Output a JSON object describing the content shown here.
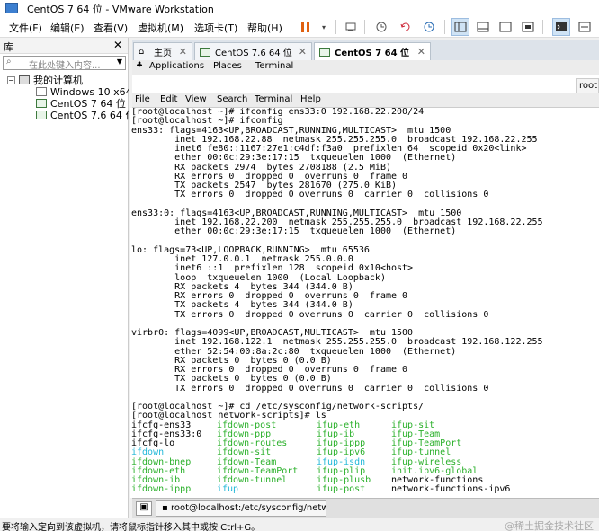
{
  "window": {
    "title": "CentOS 7 64 位 - VMware Workstation"
  },
  "menubar": {
    "items": [
      "文件(F)",
      "编辑(E)",
      "查看(V)",
      "虚拟机(M)",
      "选项卡(T)",
      "帮助(H)"
    ]
  },
  "library": {
    "title": "库",
    "search_placeholder": "在此处键入内容...",
    "tree": [
      {
        "label": "我的计算机",
        "icon": "computer-icon"
      },
      {
        "label": "Windows 10 x64",
        "icon": "vm-icon"
      },
      {
        "label": "CentOS 7 64 位",
        "icon": "vm-running-icon"
      },
      {
        "label": "CentOS 7.6 64 位",
        "icon": "vm-running-icon"
      }
    ]
  },
  "vm_tabs": [
    {
      "label": "主页",
      "icon": "home-icon"
    },
    {
      "label": "CentOS 7.6 64 位",
      "icon": "vm-running-icon"
    },
    {
      "label": "CentOS 7 64 位",
      "icon": "vm-running-icon",
      "active": true
    }
  ],
  "gnome_bar": {
    "applications": "Applications",
    "places": "Places",
    "terminal": "Terminal"
  },
  "partial_tab": "root",
  "terminal_menu": [
    "File",
    "Edit",
    "View",
    "Search",
    "Terminal",
    "Help"
  ],
  "terminal": {
    "lines": [
      "[root@localhost ~]# ifconfig ens33:0 192.168.22.200/24",
      "[root@localhost ~]# ifconfig",
      "ens33: flags=4163<UP,BROADCAST,RUNNING,MULTICAST>  mtu 1500",
      "        inet 192.168.22.88  netmask 255.255.255.0  broadcast 192.168.22.255",
      "        inet6 fe80::1167:27e1:c4df:f3a0  prefixlen 64  scopeid 0x20<link>",
      "        ether 00:0c:29:3e:17:15  txqueuelen 1000  (Ethernet)",
      "        RX packets 2974  bytes 2708188 (2.5 MiB)",
      "        RX errors 0  dropped 0  overruns 0  frame 0",
      "        TX packets 2547  bytes 281670 (275.0 KiB)",
      "        TX errors 0  dropped 0 overruns 0  carrier 0  collisions 0",
      "",
      "ens33:0: flags=4163<UP,BROADCAST,RUNNING,MULTICAST>  mtu 1500",
      "        inet 192.168.22.200  netmask 255.255.255.0  broadcast 192.168.22.255",
      "        ether 00:0c:29:3e:17:15  txqueuelen 1000  (Ethernet)",
      "",
      "lo: flags=73<UP,LOOPBACK,RUNNING>  mtu 65536",
      "        inet 127.0.0.1  netmask 255.0.0.0",
      "        inet6 ::1  prefixlen 128  scopeid 0x10<host>",
      "        loop  txqueuelen 1000  (Local Loopback)",
      "        RX packets 4  bytes 344 (344.0 B)",
      "        RX errors 0  dropped 0  overruns 0  frame 0",
      "        TX packets 4  bytes 344 (344.0 B)",
      "        TX errors 0  dropped 0 overruns 0  carrier 0  collisions 0",
      "",
      "virbr0: flags=4099<UP,BROADCAST,MULTICAST>  mtu 1500",
      "        inet 192.168.122.1  netmask 255.255.255.0  broadcast 192.168.122.255",
      "        ether 52:54:00:8a:2c:80  txqueuelen 1000  (Ethernet)",
      "        RX packets 0  bytes 0 (0.0 B)",
      "        RX errors 0  dropped 0  overruns 0  frame 0",
      "        TX packets 0  bytes 0 (0.0 B)",
      "        TX errors 0  dropped 0 overruns 0  carrier 0  collisions 0",
      "",
      "[root@localhost ~]# cd /etc/sysconfig/network-scripts/",
      "[root@localhost network-scripts]# ls"
    ],
    "ls_rows": [
      [
        {
          "t": "ifcfg-ens33",
          "c": "plain"
        },
        {
          "t": "ifdown-post",
          "c": "exec"
        },
        {
          "t": "ifup-eth",
          "c": "exec"
        },
        {
          "t": "ifup-sit",
          "c": "exec"
        }
      ],
      [
        {
          "t": "ifcfg-ens33:0",
          "c": "plain"
        },
        {
          "t": "ifdown-ppp",
          "c": "exec"
        },
        {
          "t": "ifup-ib",
          "c": "exec"
        },
        {
          "t": "ifup-Team",
          "c": "exec"
        }
      ],
      [
        {
          "t": "ifcfg-lo",
          "c": "plain"
        },
        {
          "t": "ifdown-routes",
          "c": "exec"
        },
        {
          "t": "ifup-ippp",
          "c": "exec"
        },
        {
          "t": "ifup-TeamPort",
          "c": "exec"
        }
      ],
      [
        {
          "t": "ifdown",
          "c": "link"
        },
        {
          "t": "ifdown-sit",
          "c": "exec"
        },
        {
          "t": "ifup-ipv6",
          "c": "exec"
        },
        {
          "t": "ifup-tunnel",
          "c": "exec"
        }
      ],
      [
        {
          "t": "ifdown-bnep",
          "c": "exec"
        },
        {
          "t": "ifdown-Team",
          "c": "exec"
        },
        {
          "t": "ifup-isdn",
          "c": "link"
        },
        {
          "t": "ifup-wireless",
          "c": "exec"
        }
      ],
      [
        {
          "t": "ifdown-eth",
          "c": "exec"
        },
        {
          "t": "ifdown-TeamPort",
          "c": "exec"
        },
        {
          "t": "ifup-plip",
          "c": "exec"
        },
        {
          "t": "init.ipv6-global",
          "c": "exec"
        }
      ],
      [
        {
          "t": "ifdown-ib",
          "c": "exec"
        },
        {
          "t": "ifdown-tunnel",
          "c": "exec"
        },
        {
          "t": "ifup-plusb",
          "c": "exec"
        },
        {
          "t": "network-functions",
          "c": "plain"
        }
      ],
      [
        {
          "t": "ifdown-ippp",
          "c": "exec"
        },
        {
          "t": "ifup",
          "c": "link"
        },
        {
          "t": "ifup-post",
          "c": "exec"
        },
        {
          "t": "network-functions-ipv6",
          "c": "plain"
        }
      ]
    ],
    "colors": {
      "plain": "#000000",
      "exec": "#2bb02b",
      "link": "#22b8d8"
    }
  },
  "taskbar": {
    "task_label": "root@localhost:/etc/sysconfig/netw..."
  },
  "statusbar": {
    "message": "要将输入定向到该虚拟机，请将鼠标指针移入其中或按 Ctrl+G。",
    "watermark": "@稀土掘金技术社区"
  }
}
